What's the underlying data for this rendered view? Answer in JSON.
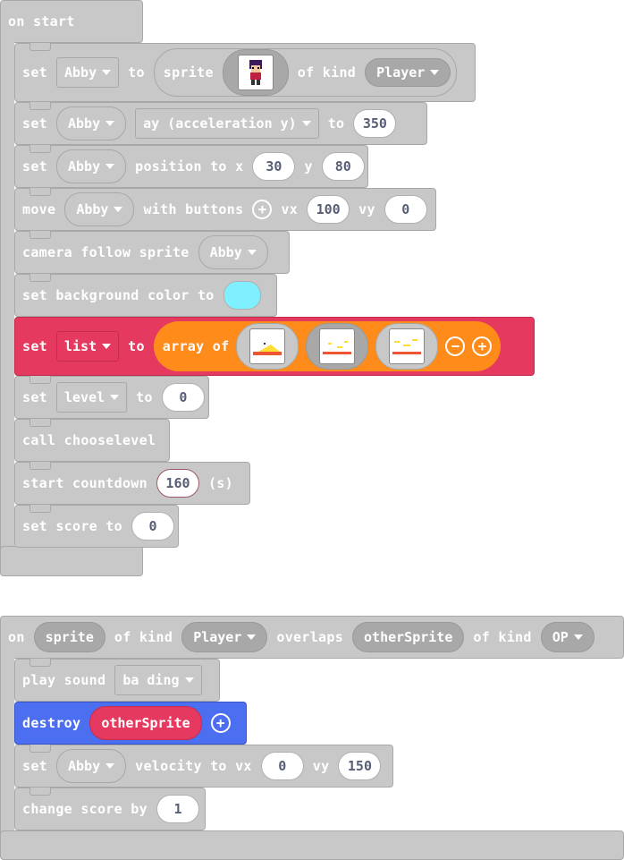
{
  "start_block": {
    "title": "on start",
    "rows": {
      "r1": {
        "set": "set",
        "var": "Abby",
        "to": "to",
        "sprite": "sprite",
        "of_kind": "of kind",
        "kind": "Player"
      },
      "r2": {
        "set": "set",
        "var": "Abby",
        "prop": "ay (acceleration y)",
        "to": "to",
        "value": "350"
      },
      "r3": {
        "set": "set",
        "var": "Abby",
        "pos": "position to x",
        "x": "30",
        "y_lbl": "y",
        "y": "80"
      },
      "r4": {
        "move": "move",
        "var": "Abby",
        "with": "with buttons",
        "vx_lbl": "vx",
        "vx": "100",
        "vy_lbl": "vy",
        "vy": "0"
      },
      "r5": {
        "text": "camera follow sprite",
        "var": "Abby"
      },
      "r6": {
        "text": "set background color to",
        "color": "#7ff0ff"
      },
      "r7": {
        "set": "set",
        "var": "list",
        "to": "to",
        "array": "array of"
      },
      "r8": {
        "set": "set",
        "var": "level",
        "to": "to",
        "value": "0"
      },
      "r9": {
        "text": "call chooselevel"
      },
      "r10": {
        "text": "start countdown",
        "value": "160",
        "unit": "(s)"
      },
      "r11": {
        "text": "set score to",
        "value": "0"
      }
    }
  },
  "overlap_block": {
    "on": "on",
    "sprite": "sprite",
    "of_kind": "of kind",
    "kind1": "Player",
    "overlaps": "overlaps",
    "other": "otherSprite",
    "of_kind2": "of kind",
    "kind2": "OP",
    "rows": {
      "r1": {
        "text": "play sound",
        "sound": "ba ding"
      },
      "r2": {
        "text": "destroy",
        "target": "otherSprite"
      },
      "r3": {
        "set": "set",
        "var": "Abby",
        "vel": "velocity to vx",
        "vx": "0",
        "vy_lbl": "vy",
        "vy": "150"
      },
      "r4": {
        "text": "change score by",
        "value": "1"
      }
    }
  },
  "colors": {
    "gray": "#c8c8c8",
    "red": "#e5395f",
    "orange": "#ff8b1b",
    "blue": "#4c6ef1",
    "cyan": "#7ff0ff"
  }
}
